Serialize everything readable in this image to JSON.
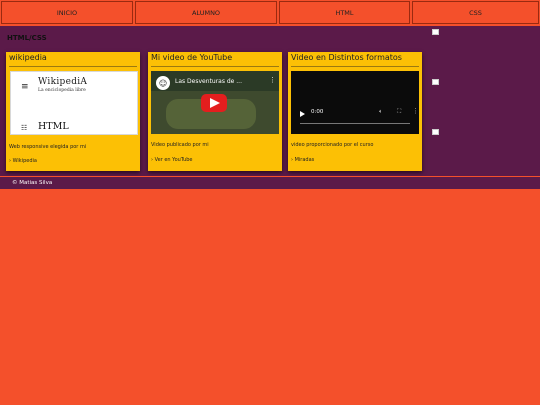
{
  "nav": {
    "items": [
      {
        "label": "INICIO"
      },
      {
        "label": "ALUMNO"
      },
      {
        "label": "HTML"
      },
      {
        "label": "CSS"
      }
    ]
  },
  "main": {
    "section_title": "HTML/CSS",
    "cards": [
      {
        "title": "wikipedia",
        "description": "Web responsive elegida por mi",
        "link": "› Wikipedia",
        "preview": {
          "menu_icon": "≡",
          "logo": "WikipediA",
          "tagline": "La enciclopedia libre",
          "list_icon": "☷",
          "heading": "HTML"
        }
      },
      {
        "title": "Mi video de YouTube",
        "description": "Video publicado por mi",
        "link": "› Ver en YouTube",
        "embed": {
          "title": "Las Desventuras de ...",
          "more": "⋮",
          "avatar": "☺"
        }
      },
      {
        "title": "Video en Distintos formatos",
        "description": "video proporcionado por el curso",
        "link": "› Miradas",
        "player": {
          "time": "0:00"
        }
      }
    ]
  },
  "footer": {
    "copyright": "© Matias Silva"
  },
  "colors": {
    "accent": "#f4502b",
    "purple": "#5b1a49",
    "card": "#fcc005"
  }
}
